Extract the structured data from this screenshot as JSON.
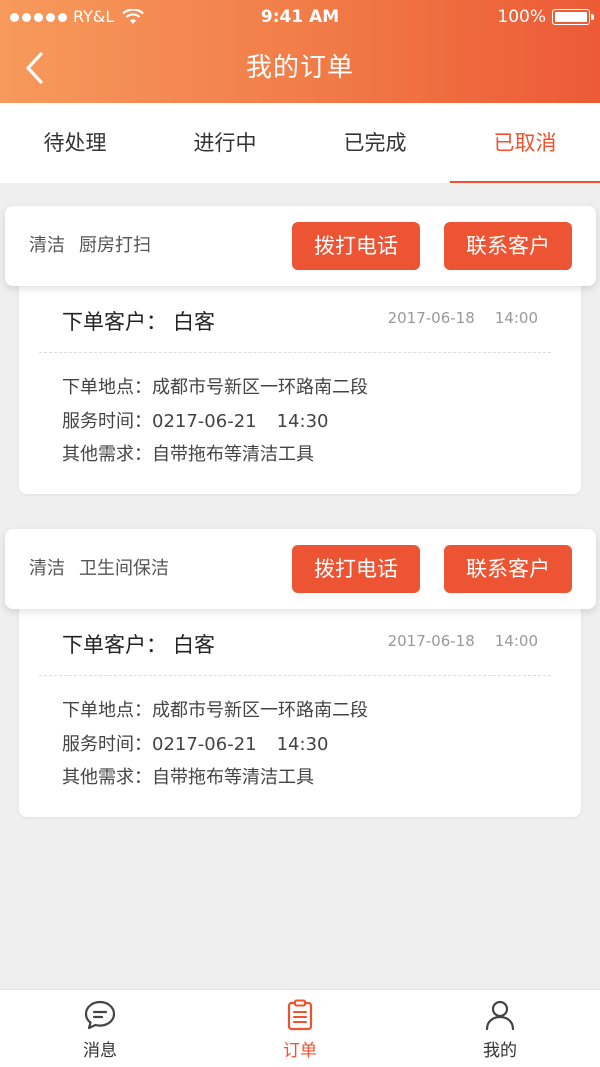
{
  "status_bar": {
    "carrier": "RY&L",
    "time": "9:41 AM",
    "battery": "100%"
  },
  "nav": {
    "title": "我的订单"
  },
  "tabs": [
    {
      "label": "待处理",
      "active": false
    },
    {
      "label": "进行中",
      "active": false
    },
    {
      "label": "已完成",
      "active": false
    },
    {
      "label": "已取消",
      "active": true
    }
  ],
  "orders": [
    {
      "service_type": "清洁",
      "service_name": "厨房打扫",
      "call_button": "拨打电话",
      "contact_button": "联系客户",
      "customer_label": "下单客户：",
      "customer_name": "白客",
      "date": "2017-06-18",
      "time": "14:00",
      "location_label": "下单地点：",
      "location": "成都市号新区一环路南二段",
      "service_time_label": "服务时间：",
      "service_date": "0217-06-21",
      "service_time": "14:30",
      "other_label": "其他需求：",
      "other": "自带拖布等清洁工具"
    },
    {
      "service_type": "清洁",
      "service_name": "卫生间保洁",
      "call_button": "拨打电话",
      "contact_button": "联系客户",
      "customer_label": "下单客户：",
      "customer_name": "白客",
      "date": "2017-06-18",
      "time": "14:00",
      "location_label": "下单地点：",
      "location": "成都市号新区一环路南二段",
      "service_time_label": "服务时间：",
      "service_date": "0217-06-21",
      "service_time": "14:30",
      "other_label": "其他需求：",
      "other": "自带拖布等清洁工具"
    }
  ],
  "bottom_nav": [
    {
      "label": "消息",
      "icon": "message-icon",
      "active": false
    },
    {
      "label": "订单",
      "icon": "order-list-icon",
      "active": true
    },
    {
      "label": "我的",
      "icon": "user-icon",
      "active": false
    }
  ],
  "colors": {
    "accent": "#f0522e",
    "header_start": "#f79a5c",
    "header_end": "#ec5a36",
    "background": "#efefef"
  }
}
